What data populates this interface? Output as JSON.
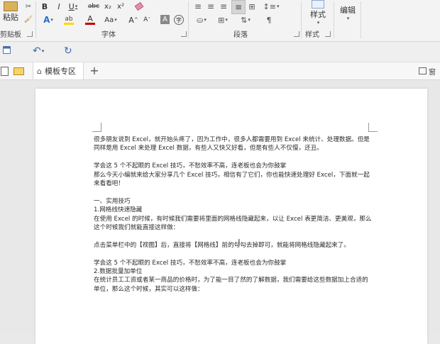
{
  "ribbon": {
    "paste_label": "粘贴",
    "clipboard_group": "剪贴板",
    "font_group": "字体",
    "paragraph_group": "段落",
    "styles_group": "样式",
    "styles_button": "样式",
    "edit_button": "编辑",
    "bold": "B",
    "italic": "I",
    "underline": "U",
    "strike": "abc",
    "subscript": "x₂",
    "superscript": "x²",
    "change_case": "Aa",
    "grow_font": "A",
    "shrink_font": "A",
    "char_border": "A"
  },
  "tabbar": {
    "tab_label": "模板专区",
    "right_label": "窗"
  },
  "document": {
    "lines": [
      "很多朋友说到 Excel，就开始头疼了，因为工作中，很多人都需要用到 Excel 来统计、处理数据。但是同样是用 Excel 来处理 Excel 数据，有些人又快又好看，但是有些人不仅慢，还丑。",
      "",
      "学会这 5 个不起眼的 Excel 技巧，不愁效率不高，连老板也会为你鼓掌",
      "那么今天小编就来给大家分享几个 Excel 技巧，相信有了它们，你也能快速处理好 Excel，下面就一起来看看吧！",
      "",
      "一、实用技巧",
      "1.网格线快速隐藏",
      "在使用 Excel 的时候，有时候我们需要将里面的网格线隐藏起来，以让 Excel 表更简洁、更美观，那么这个时候我们就能直接这样做：",
      "",
      "点击菜单栏中的【视图】后，直接将【网格线】前的勾勾去掉即可，就能将网格线隐藏起来了。",
      "",
      "学会这 5 个不起眼的 Excel 技巧，不愁效率不高，连老板也会为你鼓掌",
      "2.数据批量加单位",
      "在统计员工工资或者某一商品的价格时，为了能一目了然的了解数据，我们需要给这些数据加上合适的单位，那么这个时候，其实可以这样做："
    ]
  },
  "colors": {
    "ribbon_bg": "#f3f3f3",
    "font_color_bar": "#c00000",
    "highlight_bar": "#ffd700",
    "page_bg": "#ffffff"
  }
}
